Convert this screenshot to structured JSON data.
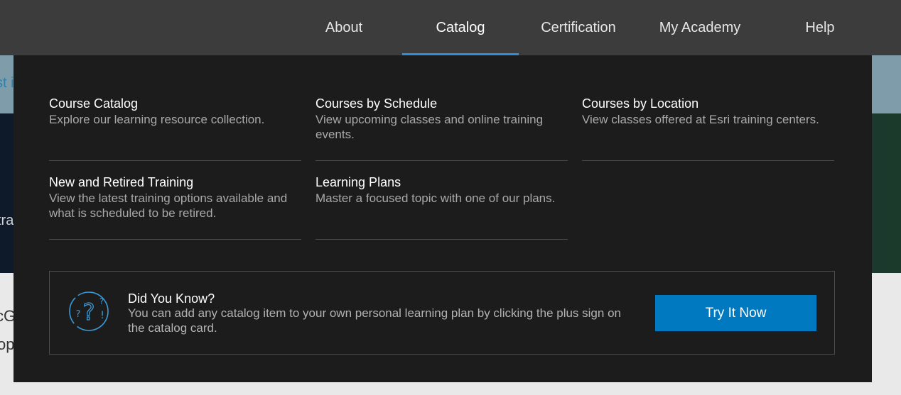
{
  "nav": {
    "items": [
      {
        "label": "About"
      },
      {
        "label": "Catalog",
        "active": true
      },
      {
        "label": "Certification"
      },
      {
        "label": "My Academy"
      },
      {
        "label": "Help"
      }
    ],
    "accent": "#2d8fd9"
  },
  "background": {
    "strip_text": "st i",
    "hero_text": "tra",
    "lower_text_1": "cG",
    "lower_text_2": "op"
  },
  "catalog_menu": {
    "items": [
      {
        "title": "Course Catalog",
        "desc": "Explore our learning resource collection."
      },
      {
        "title": "Courses by Schedule",
        "desc": "View upcoming classes and online training events."
      },
      {
        "title": "Courses by Location",
        "desc": "View classes offered at Esri training centers."
      },
      {
        "title": "New and Retired Training",
        "desc": "View the latest training options available and what is scheduled to be retired."
      },
      {
        "title": "Learning Plans",
        "desc": "Master a focused topic with one of our plans."
      }
    ]
  },
  "callout": {
    "icon": "question-marks-icon",
    "title": "Did You Know?",
    "desc": "You can add any catalog item to your own personal learning plan by clicking the plus sign on the catalog card.",
    "button_label": "Try It Now",
    "button_color": "#0079c1"
  }
}
